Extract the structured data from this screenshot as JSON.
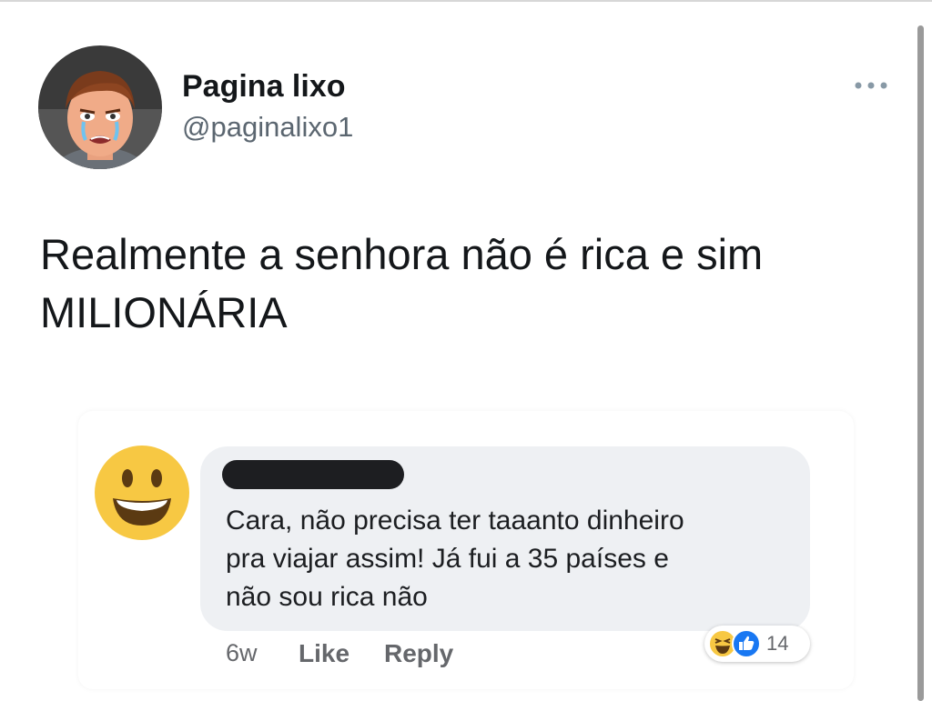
{
  "tweet": {
    "author_name": "Pagina lixo",
    "author_handle": "@paginalixo1",
    "text_line1": "Realmente a senhora não é rica e sim",
    "text_line2": "MILIONÁRIA"
  },
  "comment": {
    "line1": "Cara, não precisa ter taaanto dinheiro",
    "line2": "pra viajar assim! Já fui a 35 países e",
    "line3": "não sou rica não",
    "time": "6w",
    "like_label": "Like",
    "reply_label": "Reply",
    "reaction_count": "14",
    "reactions": [
      "haha-icon",
      "like-icon"
    ]
  },
  "colors": {
    "text": "#14171a",
    "handle": "#5b6670",
    "bubble": "#eef0f3",
    "like_blue": "#1877f2",
    "emoji_yellow": "#f7c843"
  }
}
